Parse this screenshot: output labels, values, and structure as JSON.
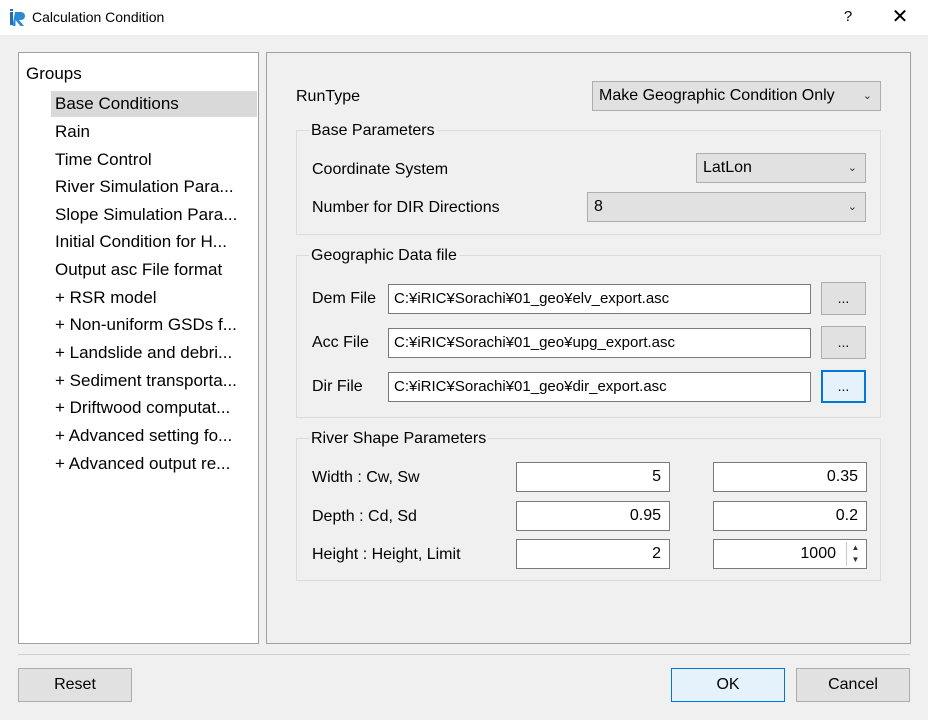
{
  "window": {
    "title": "Calculation Condition",
    "help_label": "?",
    "close_label": "✕"
  },
  "groups": {
    "header": "Groups",
    "items": [
      {
        "label": "Base Conditions"
      },
      {
        "label": "Rain"
      },
      {
        "label": "Time Control"
      },
      {
        "label": "River Simulation Para..."
      },
      {
        "label": "Slope Simulation Para..."
      },
      {
        "label": "Initial Condition for H..."
      },
      {
        "label": "Output asc File format"
      },
      {
        "label": "+ RSR model"
      },
      {
        "label": "+ Non-uniform GSDs f..."
      },
      {
        "label": "+ Landslide and debri..."
      },
      {
        "label": "+ Sediment transporta..."
      },
      {
        "label": "+ Driftwood computat..."
      },
      {
        "label": "+ Advanced setting fo..."
      },
      {
        "label": "+ Advanced output re..."
      }
    ],
    "selected_index": 0
  },
  "main": {
    "runtype_label": "RunType",
    "runtype_value": "Make Geographic Condition Only",
    "base_params": {
      "title": "Base Parameters",
      "coord_label": "Coordinate System",
      "coord_value": "LatLon",
      "dir_label": "Number for DIR Directions",
      "dir_value": "8"
    },
    "geo_data": {
      "title": "Geographic Data file",
      "dem_label": "Dem File",
      "dem_value": "C:¥iRIC¥Sorachi¥01_geo¥elv_export.asc",
      "acc_label": "Acc File",
      "acc_value": "C:¥iRIC¥Sorachi¥01_geo¥upg_export.asc",
      "dir_label": "Dir File",
      "dir_value": "C:¥iRIC¥Sorachi¥01_geo¥dir_export.asc",
      "browse_label": "..."
    },
    "river_shape": {
      "title": "River Shape Parameters",
      "width_label": "Width : Cw, Sw",
      "width_cw": "5",
      "width_sw": "0.35",
      "depth_label": "Depth : Cd, Sd",
      "depth_cd": "0.95",
      "depth_sd": "0.2",
      "height_label": "Height : Height, Limit",
      "height_value": "2",
      "limit_value": "1000"
    }
  },
  "footer": {
    "reset_label": "Reset",
    "ok_label": "OK",
    "cancel_label": "Cancel"
  },
  "colors": {
    "accent": "#0078d7",
    "selection": "#d9d9d9",
    "background": "#f0f0f0"
  },
  "icons": {
    "app": "iric-logo-icon",
    "combo": "chevron-down-icon",
    "spin": "spin-arrows-icon"
  }
}
